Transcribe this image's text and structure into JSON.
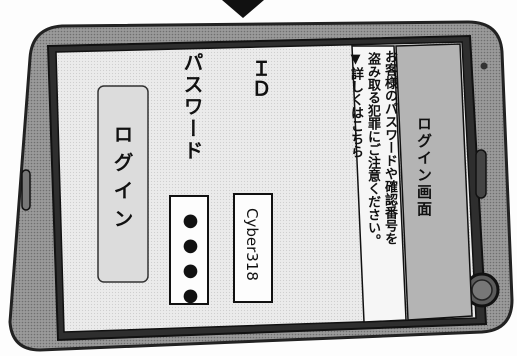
{
  "screen": {
    "title": "ログイン画面",
    "notice_line1": "お客様のパスワードや確認番号を",
    "notice_line2": "盗み取る犯罪にご注意ください。",
    "notice_link": "▼詳しくはこちら"
  },
  "form": {
    "id_label": "ＩＤ",
    "id_value": "Cyber318",
    "password_label": "パスワード",
    "password_value": "●●●●",
    "login_label": "ログイン"
  },
  "icons": [
    "arrow-down-icon",
    "home-button-icon",
    "speaker-icon",
    "side-button-icon"
  ],
  "colors": {
    "phone_body": "#8a8a8a",
    "phone_dark": "#3c3c3c",
    "screen_bg": "#e3e3e3",
    "panel_bg": "#f6f6f6",
    "title_bar": "#b4b4b4",
    "login_button": "#d8d8d8",
    "text": "#111111"
  }
}
